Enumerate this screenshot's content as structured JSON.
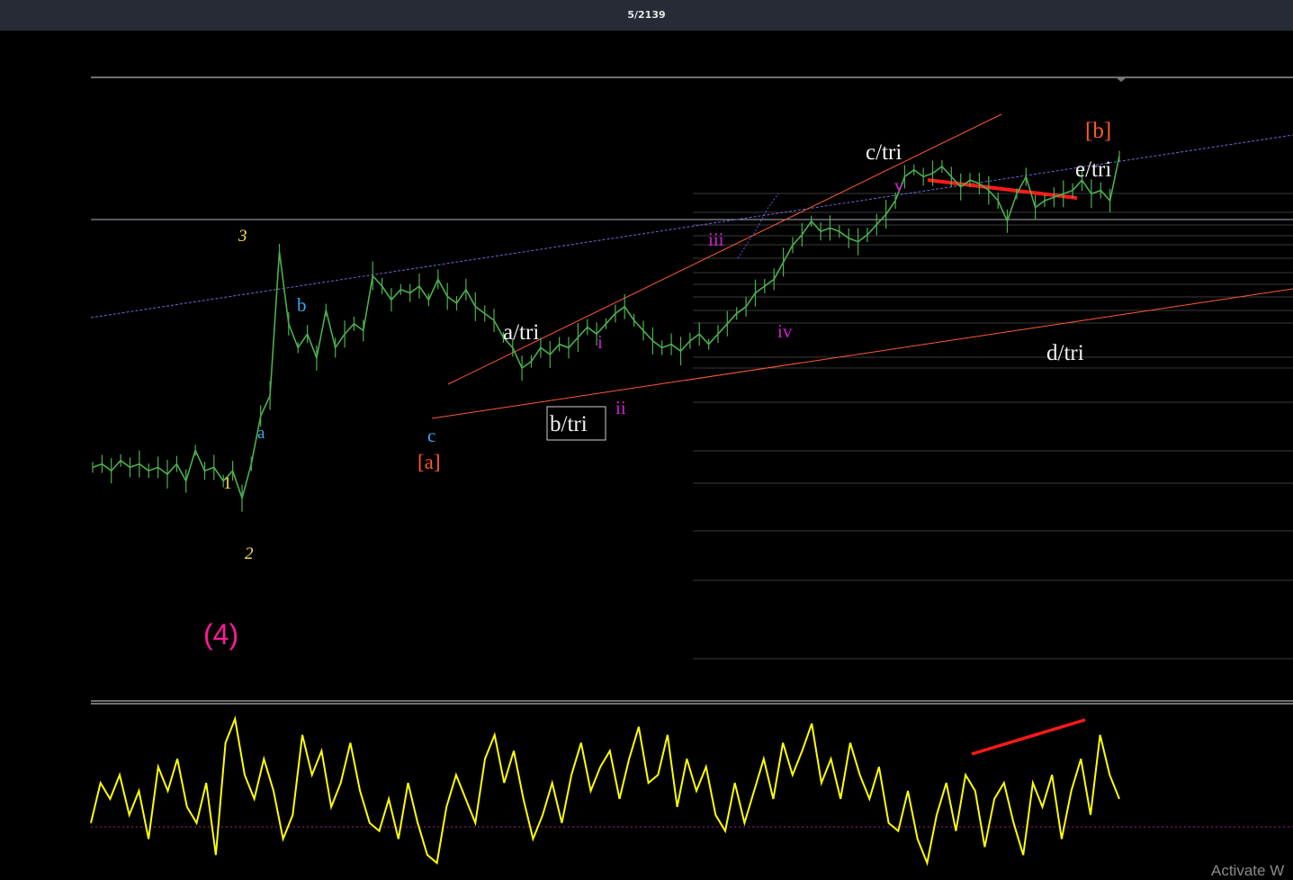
{
  "header": {
    "title": "5/2139"
  },
  "watermark": "Activate W",
  "colors": {
    "background": "#000000",
    "price_line": "#4caf50",
    "oscillator": "#ffff00",
    "trendline": "#ff5a36",
    "divergence": "#ff1a1a",
    "channel": "#6a6ad8",
    "grid": "#3a3a3a",
    "label_white": "#f2f2f2",
    "label_yellow": "#ffe14d",
    "label_blue": "#35a8f0",
    "label_magenta": "#d020d0",
    "label_orange": "#ff5a2a",
    "label_pink": "#ff1a9a"
  },
  "chart_data": [
    {
      "type": "line",
      "pane": "price",
      "grid": true,
      "series": [
        {
          "values": [
            0.37,
            0.38,
            0.36,
            0.39,
            0.37,
            0.38,
            0.36,
            0.37,
            0.35,
            0.38,
            0.33,
            0.42,
            0.36,
            0.37,
            0.33,
            0.36,
            0.28,
            0.38,
            0.52,
            0.58,
            1.0,
            0.79,
            0.72,
            0.76,
            0.69,
            0.83,
            0.72,
            0.76,
            0.79,
            0.77,
            0.93,
            0.9,
            0.86,
            0.89,
            0.88,
            0.9,
            0.86,
            0.92,
            0.87,
            0.85,
            0.89,
            0.84,
            0.82,
            0.8,
            0.75,
            0.72,
            0.66,
            0.68,
            0.72,
            0.7,
            0.73,
            0.72,
            0.75,
            0.78,
            0.76,
            0.79,
            0.82,
            0.84,
            0.8,
            0.77,
            0.74,
            0.72,
            0.73,
            0.71,
            0.74,
            0.76,
            0.73,
            0.76,
            0.79,
            0.82,
            0.84,
            0.88,
            0.9,
            0.92,
            0.97,
            1.02,
            1.05,
            1.09,
            1.06,
            1.07,
            1.06,
            1.04,
            1.03,
            1.05,
            1.08,
            1.11,
            1.15,
            1.22,
            1.24,
            1.22,
            1.23,
            1.25,
            1.22,
            1.19,
            1.21,
            1.2,
            1.18,
            1.15,
            1.09,
            1.17,
            1.22,
            1.13,
            1.15,
            1.16,
            1.17,
            1.18,
            1.21,
            1.17,
            1.18,
            1.15,
            1.28
          ]
        }
      ],
      "price_annotations": [
        "(4)",
        "1",
        "2",
        "3",
        "a",
        "b",
        "c",
        "[a]",
        "a/tri",
        "b/tri",
        "i",
        "ii",
        "iii",
        "iv",
        "v",
        "c/tri",
        "d/tri",
        "e/tri",
        "[b]"
      ]
    },
    {
      "type": "line",
      "pane": "oscillator",
      "grid": false,
      "series": [
        {
          "values": [
            0.3,
            0.55,
            0.45,
            0.6,
            0.35,
            0.5,
            0.2,
            0.65,
            0.5,
            0.7,
            0.4,
            0.3,
            0.55,
            0.1,
            0.8,
            0.95,
            0.6,
            0.45,
            0.7,
            0.5,
            0.2,
            0.35,
            0.85,
            0.6,
            0.75,
            0.4,
            0.55,
            0.8,
            0.5,
            0.3,
            0.25,
            0.45,
            0.2,
            0.55,
            0.3,
            0.1,
            0.05,
            0.4,
            0.6,
            0.45,
            0.3,
            0.7,
            0.85,
            0.55,
            0.75,
            0.45,
            0.2,
            0.35,
            0.55,
            0.3,
            0.6,
            0.8,
            0.5,
            0.65,
            0.75,
            0.45,
            0.7,
            0.9,
            0.55,
            0.6,
            0.85,
            0.4,
            0.7,
            0.5,
            0.65,
            0.35,
            0.25,
            0.55,
            0.3,
            0.5,
            0.7,
            0.45,
            0.8,
            0.6,
            0.75,
            0.92,
            0.55,
            0.7,
            0.45,
            0.8,
            0.6,
            0.45,
            0.65,
            0.3,
            0.25,
            0.5,
            0.2,
            0.05,
            0.35,
            0.55,
            0.25,
            0.6,
            0.5,
            0.15,
            0.45,
            0.55,
            0.3,
            0.1,
            0.55,
            0.4,
            0.6,
            0.2,
            0.5,
            0.7,
            0.35,
            0.85,
            0.6,
            0.45
          ]
        }
      ],
      "reference_level": 0.2
    }
  ],
  "annotations": {
    "wave_4": "(4)",
    "w1": "1",
    "w2": "2",
    "w3": "3",
    "wa": "a",
    "wb": "b",
    "wc": "c",
    "bracket_a": "[a]",
    "a_tri": "a/tri",
    "b_tri": "b/tri",
    "c_tri": "c/tri",
    "d_tri": "d/tri",
    "e_tri": "e/tri",
    "bracket_b": "[b]",
    "ri": "i",
    "rii": "ii",
    "riii": "iii",
    "riv": "iv",
    "rv": "v"
  }
}
